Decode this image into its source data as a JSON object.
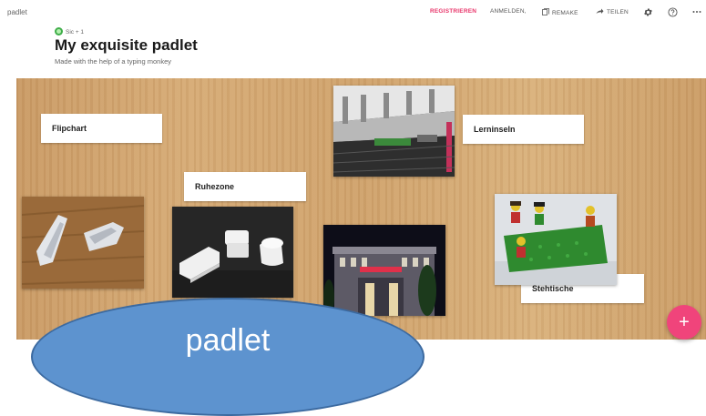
{
  "header": {
    "brand": "padlet",
    "nav": {
      "register": "REGISTRIEREN",
      "login": "ANMELDEN,",
      "remake": "REMAKE",
      "share": "TEILEN"
    },
    "owner": "Sic + 1",
    "title": "My exquisite padlet",
    "subtitle": "Made with the help of a typing monkey"
  },
  "posts": {
    "flipchart": "Flipchart",
    "lerninseln": "Lerninseln",
    "ruhezone": "Ruhezone",
    "stehtische": "Stehtische"
  },
  "overlay_label": "padlet",
  "fab_label": "+",
  "colors": {
    "accent": "#e8356a",
    "fab": "#f0447b",
    "overlay": "#5d93cf"
  }
}
